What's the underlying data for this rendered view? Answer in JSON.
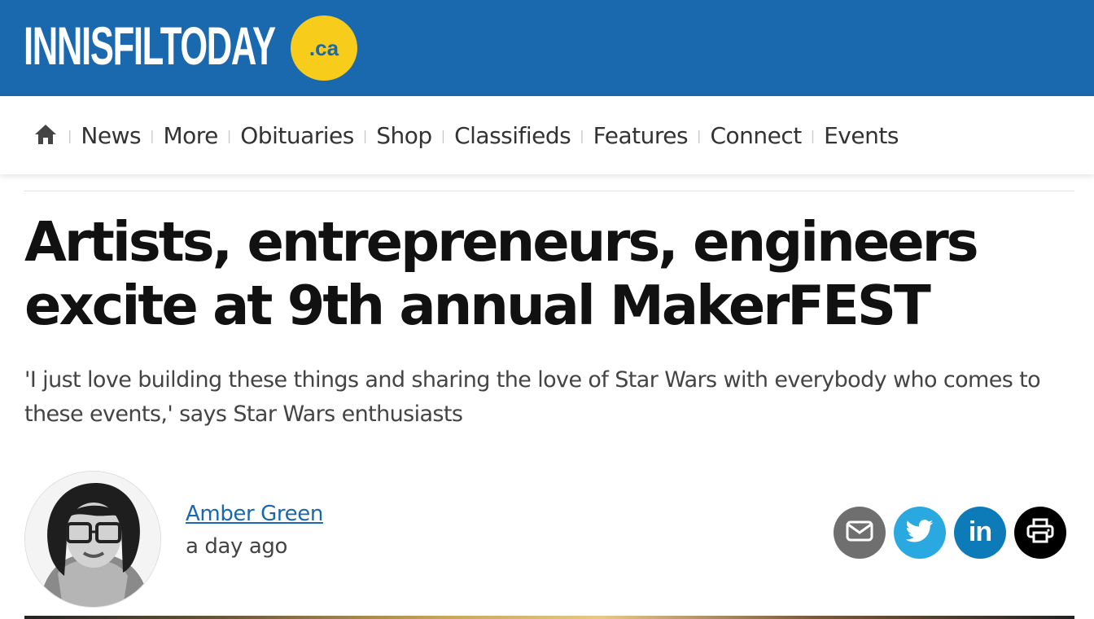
{
  "site": {
    "logo_text": "INNISFILTODAY",
    "logo_badge": ".ca",
    "brand_color": "#1a68ad",
    "badge_color": "#f8cc1b"
  },
  "nav": {
    "home_icon": "home-icon",
    "items": [
      {
        "label": "News"
      },
      {
        "label": "More"
      },
      {
        "label": "Obituaries"
      },
      {
        "label": "Shop"
      },
      {
        "label": "Classifieds"
      },
      {
        "label": "Features"
      },
      {
        "label": "Connect"
      },
      {
        "label": "Events"
      }
    ],
    "separator": "|"
  },
  "article": {
    "headline": "Artists, entrepreneurs, engineers excite at 9th annual MakerFEST",
    "subheadline": "'I just love building these things and sharing the love of Star Wars with everybody who comes to these events,' says Star Wars enthusiasts",
    "author": {
      "name": "Amber Green",
      "published": "a day ago"
    }
  },
  "share": {
    "buttons": [
      {
        "name": "email",
        "icon": "envelope-icon",
        "color": "#6f6f6f"
      },
      {
        "name": "twitter",
        "icon": "twitter-bird-icon",
        "color": "#29a9e0"
      },
      {
        "name": "linkedin",
        "icon": "linkedin-icon",
        "label": "in",
        "color": "#0c7bb8"
      },
      {
        "name": "print",
        "icon": "printer-icon",
        "color": "#000000"
      }
    ]
  }
}
